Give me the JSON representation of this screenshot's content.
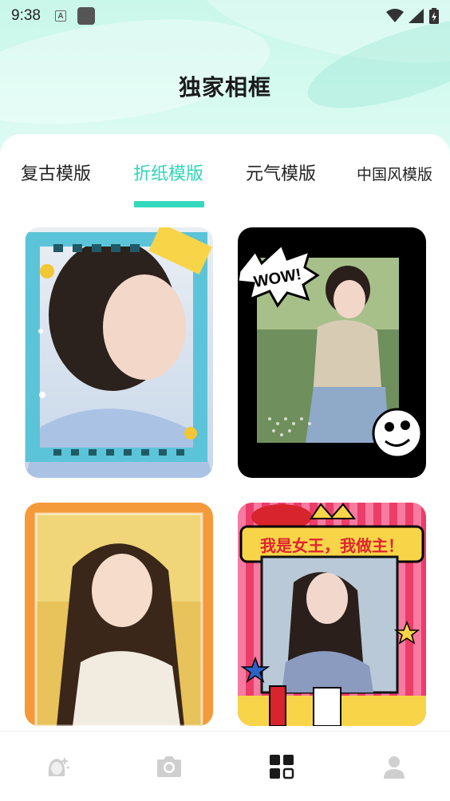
{
  "status_bar": {
    "time": "9:38",
    "notification_letter": "A"
  },
  "header": {
    "title": "独家相框"
  },
  "tabs": [
    {
      "label": "复古模版",
      "active": false
    },
    {
      "label": "折纸模版",
      "active": true
    },
    {
      "label": "元气模版",
      "active": false
    },
    {
      "label": "中国风模版",
      "active": false
    }
  ],
  "frames": [
    {
      "name": "film-strip-frame",
      "border_color": "#5cc4d8",
      "frame_style": "film-strip"
    },
    {
      "name": "comic-wow-frame",
      "border_color": "#000000",
      "frame_style": "comic-wow",
      "sticker_text": "WOW!"
    },
    {
      "name": "orange-frame",
      "border_color": "#f49a3a",
      "frame_style": "plain-orange"
    },
    {
      "name": "queen-pop-frame",
      "border_color": "#ec3d6a",
      "frame_style": "pop-art",
      "banner_text": "我是女王，我做主！"
    }
  ],
  "bottom_nav": [
    {
      "icon": "portrait-sparkle-icon",
      "active": false
    },
    {
      "icon": "camera-icon",
      "active": false
    },
    {
      "icon": "grid-icon",
      "active": true
    },
    {
      "icon": "person-icon",
      "active": false
    }
  ],
  "colors": {
    "accent": "#33d9bd",
    "header_bg": "#c9f7ea",
    "nav_active": "#222222",
    "nav_inactive": "#c8c8c8"
  }
}
